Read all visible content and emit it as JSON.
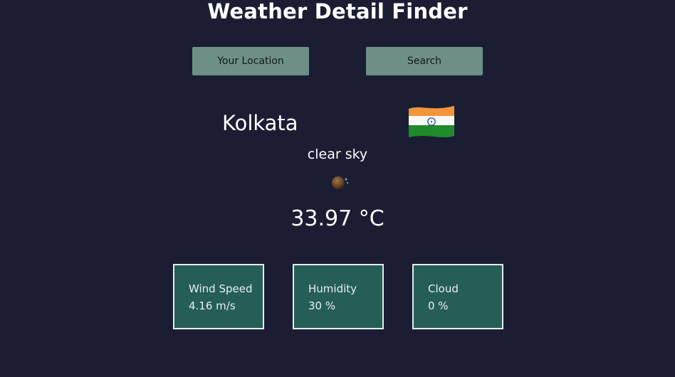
{
  "app": {
    "title": "Weather Detail Finder"
  },
  "controls": {
    "location_label": "Your Location",
    "search_label": "Search"
  },
  "weather": {
    "city": "Kolkata",
    "country_flag": "india-flag",
    "description": "clear sky",
    "icon": "clear-sky-icon",
    "temperature": "33.97 °C"
  },
  "details": [
    {
      "label": "Wind Speed",
      "value": "4.16 m/s"
    },
    {
      "label": "Humidity",
      "value": "30 %"
    },
    {
      "label": "Cloud",
      "value": "0 %"
    }
  ],
  "colors": {
    "background": "#1b1d33",
    "button": "#6e8f86",
    "card": "#255e57",
    "card_border": "#e6ebea",
    "text": "#ffffff"
  }
}
